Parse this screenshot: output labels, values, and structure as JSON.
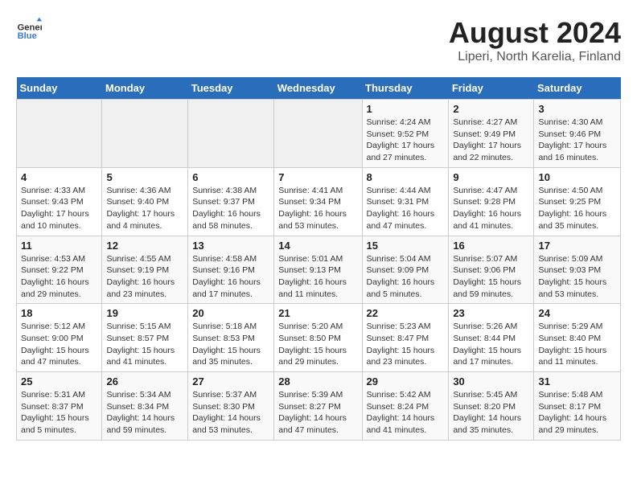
{
  "header": {
    "logo_general": "General",
    "logo_blue": "Blue",
    "title": "August 2024",
    "subtitle": "Liperi, North Karelia, Finland"
  },
  "weekdays": [
    "Sunday",
    "Monday",
    "Tuesday",
    "Wednesday",
    "Thursday",
    "Friday",
    "Saturday"
  ],
  "weeks": [
    [
      {
        "day": "",
        "info": ""
      },
      {
        "day": "",
        "info": ""
      },
      {
        "day": "",
        "info": ""
      },
      {
        "day": "",
        "info": ""
      },
      {
        "day": "1",
        "info": "Sunrise: 4:24 AM\nSunset: 9:52 PM\nDaylight: 17 hours\nand 27 minutes."
      },
      {
        "day": "2",
        "info": "Sunrise: 4:27 AM\nSunset: 9:49 PM\nDaylight: 17 hours\nand 22 minutes."
      },
      {
        "day": "3",
        "info": "Sunrise: 4:30 AM\nSunset: 9:46 PM\nDaylight: 17 hours\nand 16 minutes."
      }
    ],
    [
      {
        "day": "4",
        "info": "Sunrise: 4:33 AM\nSunset: 9:43 PM\nDaylight: 17 hours\nand 10 minutes."
      },
      {
        "day": "5",
        "info": "Sunrise: 4:36 AM\nSunset: 9:40 PM\nDaylight: 17 hours\nand 4 minutes."
      },
      {
        "day": "6",
        "info": "Sunrise: 4:38 AM\nSunset: 9:37 PM\nDaylight: 16 hours\nand 58 minutes."
      },
      {
        "day": "7",
        "info": "Sunrise: 4:41 AM\nSunset: 9:34 PM\nDaylight: 16 hours\nand 53 minutes."
      },
      {
        "day": "8",
        "info": "Sunrise: 4:44 AM\nSunset: 9:31 PM\nDaylight: 16 hours\nand 47 minutes."
      },
      {
        "day": "9",
        "info": "Sunrise: 4:47 AM\nSunset: 9:28 PM\nDaylight: 16 hours\nand 41 minutes."
      },
      {
        "day": "10",
        "info": "Sunrise: 4:50 AM\nSunset: 9:25 PM\nDaylight: 16 hours\nand 35 minutes."
      }
    ],
    [
      {
        "day": "11",
        "info": "Sunrise: 4:53 AM\nSunset: 9:22 PM\nDaylight: 16 hours\nand 29 minutes."
      },
      {
        "day": "12",
        "info": "Sunrise: 4:55 AM\nSunset: 9:19 PM\nDaylight: 16 hours\nand 23 minutes."
      },
      {
        "day": "13",
        "info": "Sunrise: 4:58 AM\nSunset: 9:16 PM\nDaylight: 16 hours\nand 17 minutes."
      },
      {
        "day": "14",
        "info": "Sunrise: 5:01 AM\nSunset: 9:13 PM\nDaylight: 16 hours\nand 11 minutes."
      },
      {
        "day": "15",
        "info": "Sunrise: 5:04 AM\nSunset: 9:09 PM\nDaylight: 16 hours\nand 5 minutes."
      },
      {
        "day": "16",
        "info": "Sunrise: 5:07 AM\nSunset: 9:06 PM\nDaylight: 15 hours\nand 59 minutes."
      },
      {
        "day": "17",
        "info": "Sunrise: 5:09 AM\nSunset: 9:03 PM\nDaylight: 15 hours\nand 53 minutes."
      }
    ],
    [
      {
        "day": "18",
        "info": "Sunrise: 5:12 AM\nSunset: 9:00 PM\nDaylight: 15 hours\nand 47 minutes."
      },
      {
        "day": "19",
        "info": "Sunrise: 5:15 AM\nSunset: 8:57 PM\nDaylight: 15 hours\nand 41 minutes."
      },
      {
        "day": "20",
        "info": "Sunrise: 5:18 AM\nSunset: 8:53 PM\nDaylight: 15 hours\nand 35 minutes."
      },
      {
        "day": "21",
        "info": "Sunrise: 5:20 AM\nSunset: 8:50 PM\nDaylight: 15 hours\nand 29 minutes."
      },
      {
        "day": "22",
        "info": "Sunrise: 5:23 AM\nSunset: 8:47 PM\nDaylight: 15 hours\nand 23 minutes."
      },
      {
        "day": "23",
        "info": "Sunrise: 5:26 AM\nSunset: 8:44 PM\nDaylight: 15 hours\nand 17 minutes."
      },
      {
        "day": "24",
        "info": "Sunrise: 5:29 AM\nSunset: 8:40 PM\nDaylight: 15 hours\nand 11 minutes."
      }
    ],
    [
      {
        "day": "25",
        "info": "Sunrise: 5:31 AM\nSunset: 8:37 PM\nDaylight: 15 hours\nand 5 minutes."
      },
      {
        "day": "26",
        "info": "Sunrise: 5:34 AM\nSunset: 8:34 PM\nDaylight: 14 hours\nand 59 minutes."
      },
      {
        "day": "27",
        "info": "Sunrise: 5:37 AM\nSunset: 8:30 PM\nDaylight: 14 hours\nand 53 minutes."
      },
      {
        "day": "28",
        "info": "Sunrise: 5:39 AM\nSunset: 8:27 PM\nDaylight: 14 hours\nand 47 minutes."
      },
      {
        "day": "29",
        "info": "Sunrise: 5:42 AM\nSunset: 8:24 PM\nDaylight: 14 hours\nand 41 minutes."
      },
      {
        "day": "30",
        "info": "Sunrise: 5:45 AM\nSunset: 8:20 PM\nDaylight: 14 hours\nand 35 minutes."
      },
      {
        "day": "31",
        "info": "Sunrise: 5:48 AM\nSunset: 8:17 PM\nDaylight: 14 hours\nand 29 minutes."
      }
    ]
  ]
}
